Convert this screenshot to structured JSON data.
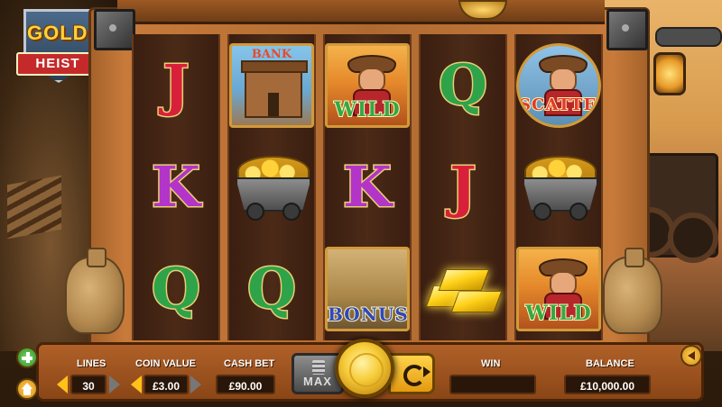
{
  "logo": {
    "line1": "GOLD",
    "line2": "HEIST"
  },
  "reels": [
    [
      {
        "kind": "letter",
        "symbol": "J"
      },
      {
        "kind": "letter",
        "symbol": "K"
      },
      {
        "kind": "letter",
        "symbol": "Q"
      }
    ],
    [
      {
        "kind": "bank",
        "label": "BANK"
      },
      {
        "kind": "minecart"
      },
      {
        "kind": "letter",
        "symbol": "Q"
      }
    ],
    [
      {
        "kind": "wild",
        "label": "WILD"
      },
      {
        "kind": "letter",
        "symbol": "K"
      },
      {
        "kind": "bonus",
        "label": "BONUS"
      }
    ],
    [
      {
        "kind": "letter",
        "symbol": "Q"
      },
      {
        "kind": "letter",
        "symbol": "J"
      },
      {
        "kind": "goldbars"
      }
    ],
    [
      {
        "kind": "scatter",
        "label": "SCATTER"
      },
      {
        "kind": "minecart"
      },
      {
        "kind": "wild",
        "label": "WILD"
      }
    ]
  ],
  "panel": {
    "lines": {
      "label": "LINES",
      "value": "30"
    },
    "coin_value": {
      "label": "COIN VALUE",
      "value": "£3.00"
    },
    "cash_bet": {
      "label": "CASH BET",
      "value": "£90.00"
    },
    "max_label": "MAX",
    "win": {
      "label": "WIN",
      "value": ""
    },
    "balance": {
      "label": "BALANCE",
      "value": "£10,000.00"
    }
  },
  "icons": {
    "menu": "plus-icon",
    "home": "home-icon",
    "sound": "sound-icon",
    "spin": "spin-icon",
    "autoplay": "autoplay-icon"
  },
  "colors": {
    "J": "#d8203a",
    "K": "#b334c9",
    "Q": "#2ea34a",
    "accent": "#ffc21a"
  }
}
